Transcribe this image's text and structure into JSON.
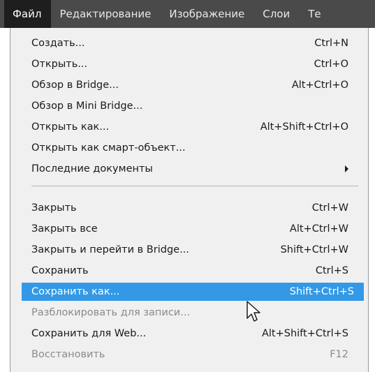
{
  "menubar": {
    "tabs": [
      "Файл",
      "Редактирование",
      "Изображение",
      "Слои",
      "Те"
    ]
  },
  "menu": {
    "items": [
      {
        "label": "Создать...",
        "shortcut": "Ctrl+N"
      },
      {
        "label": "Открыть...",
        "shortcut": "Ctrl+O"
      },
      {
        "label": "Обзор в Bridge...",
        "shortcut": "Alt+Ctrl+O"
      },
      {
        "label": "Обзор в Mini Bridge...",
        "shortcut": ""
      },
      {
        "label": "Открыть как...",
        "shortcut": "Alt+Shift+Ctrl+O"
      },
      {
        "label": "Открыть как смарт-объект...",
        "shortcut": ""
      },
      {
        "label": "Последние документы",
        "shortcut": "",
        "submenu": true
      },
      {
        "label": "Закрыть",
        "shortcut": "Ctrl+W"
      },
      {
        "label": "Закрыть все",
        "shortcut": "Alt+Ctrl+W"
      },
      {
        "label": "Закрыть и перейти в Bridge...",
        "shortcut": "Shift+Ctrl+W"
      },
      {
        "label": "Сохранить",
        "shortcut": "Ctrl+S"
      },
      {
        "label": "Сохранить как...",
        "shortcut": "Shift+Ctrl+S",
        "highlighted": true
      },
      {
        "label": "Разблокировать для записи...",
        "shortcut": "",
        "disabled": true
      },
      {
        "label": "Сохранить для Web...",
        "shortcut": "Alt+Shift+Ctrl+S"
      },
      {
        "label": "Восстановить",
        "shortcut": "F12",
        "disabled": true
      }
    ]
  },
  "colors": {
    "highlight": "#3399e6",
    "menubar": "#4a4a4a",
    "active_tab": "#1e1e1e",
    "disabled_text": "#8a8a8a"
  }
}
